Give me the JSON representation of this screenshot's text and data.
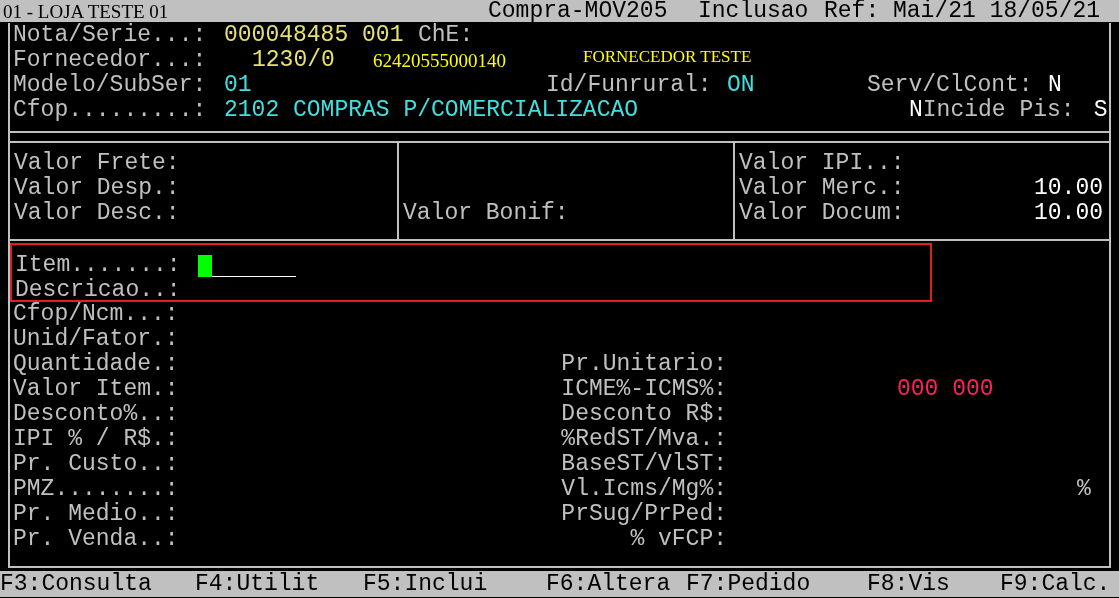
{
  "title_bar": {
    "store": "01 - LOJA TESTE 01",
    "program": "Compra-MOV205",
    "mode": "Inclusao",
    "reference": "Ref: Mai/21 18/05/21"
  },
  "header": {
    "nota": {
      "label": "Nota/Serie...:",
      "value": "000048485 001",
      "extra_label": "ChE:"
    },
    "fornecedor": {
      "label": "Fornecedor...:",
      "code": "1230/0",
      "cnpj": "62420555000140",
      "name": "FORNECEDOR TESTE"
    },
    "modelo": {
      "label": "Modelo/SubSer:",
      "value": "01"
    },
    "funrural": {
      "label": "Id/Funrural:",
      "value": "ON"
    },
    "serv": {
      "label": "Serv/ClCont:",
      "value": "N"
    },
    "cfop": {
      "label": "Cfop.........:",
      "value": "2102 COMPRAS P/COMERCIALIZACAO"
    },
    "nincide": {
      "flag": "N",
      "label": "Incide Pis:",
      "value": "S"
    }
  },
  "totals": [
    {
      "fields": [
        {
          "label": "Valor Frete:"
        },
        {
          "label": "Valor Desp.:"
        },
        {
          "label": "Valor Desc.:"
        }
      ]
    },
    {
      "fields": [
        {
          "label": "Valor Bonif:"
        }
      ]
    },
    {
      "fields": [
        {
          "label": "Valor IPI..:"
        },
        {
          "label": "Valor Merc.:",
          "value": "10.00"
        },
        {
          "label": "Valor Docum:",
          "value": "10.00"
        }
      ]
    }
  ],
  "item_entry": {
    "item_label": "Item.......:",
    "description_label": "Descricao..:",
    "focused": true
  },
  "item_fields": [
    {
      "left": "Cfop/Ncm...:"
    },
    {
      "left": "Unid/Fator.:"
    },
    {
      "left": "Quantidade.:",
      "right": "Pr.Unitario:"
    },
    {
      "left": "Valor Item.:",
      "right": "ICME%-ICMS%:",
      "value": "000 000"
    },
    {
      "left": "Desconto%..:",
      "right": "Desconto R$:"
    },
    {
      "left": "IPI % / R$.:",
      "right": "%RedST/Mva.:"
    },
    {
      "left": "Pr. Custo..:",
      "right": "BaseST/VlST:"
    },
    {
      "left": "PMZ........:",
      "right": "Vl.Icms/Mg%:",
      "suffix": "%"
    },
    {
      "left": "Pr. Medio..:",
      "right": "PrSug/PrPed:"
    },
    {
      "left": "Pr. Venda..:",
      "right": "% vFCP:"
    }
  ],
  "function_keys": [
    "F3:Consulta",
    "F4:Utilit",
    "F5:Inclui",
    "F6:Altera",
    "F7:Pedido",
    "F8:Vis",
    "F9:Calc."
  ]
}
